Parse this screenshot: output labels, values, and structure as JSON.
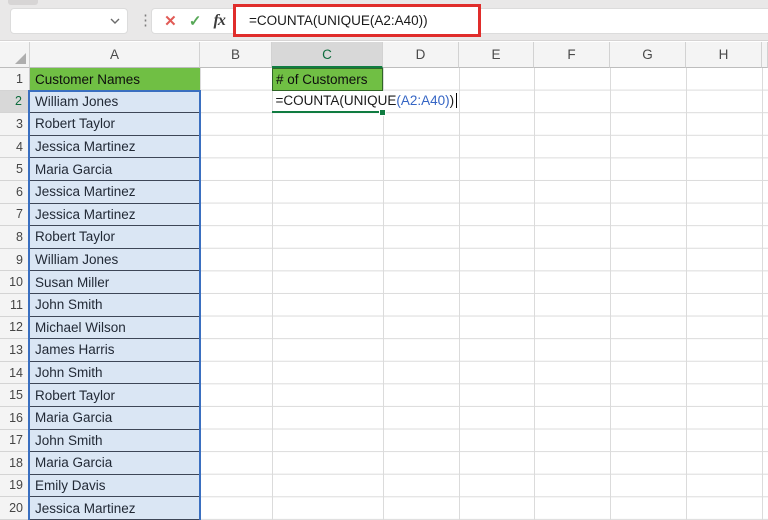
{
  "topbar": {
    "name_box_value": "",
    "separator_dots": "⋮",
    "cancel_label": "✕",
    "enter_label": "✓",
    "fx_label": "fx",
    "formula": "=COUNTA(UNIQUE(A2:A40))"
  },
  "sheet": {
    "column_headers": [
      "A",
      "B",
      "C",
      "D",
      "E",
      "F",
      "G",
      "H"
    ],
    "active_column": "C",
    "active_row": "2",
    "row_numbers": [
      "1",
      "2",
      "3",
      "4",
      "5",
      "6",
      "7",
      "8",
      "9",
      "10",
      "11",
      "12",
      "13",
      "14",
      "15",
      "16",
      "17",
      "18",
      "19",
      "20"
    ],
    "cells": {
      "A1": "Customer Names",
      "C1": "# of Customers"
    },
    "customer_names": [
      "William Jones",
      "Robert Taylor",
      "Jessica Martinez",
      "Maria Garcia",
      "Jessica Martinez",
      "Jessica Martinez",
      "Robert Taylor",
      "William Jones",
      "Susan Miller",
      "John Smith",
      "Michael Wilson",
      "James Harris",
      "John Smith",
      "Robert Taylor",
      "Maria Garcia",
      "John Smith",
      "Maria Garcia",
      "Emily Davis",
      "Jessica Martinez"
    ],
    "edit_cell": {
      "address": "C2",
      "formula_pre": "=COUNTA(UNIQUE",
      "formula_ref": "(A2:A40)",
      "formula_post": ")"
    }
  },
  "colors": {
    "header_fill_green": "#70BF44",
    "excel_selection_green": "#107C41",
    "range_highlight_blue": "#3A6FC0",
    "range_fill_blue": "#E3ECF7",
    "formula_ref_blue": "#3565C4",
    "highlight_box_red": "#E02D2B"
  }
}
